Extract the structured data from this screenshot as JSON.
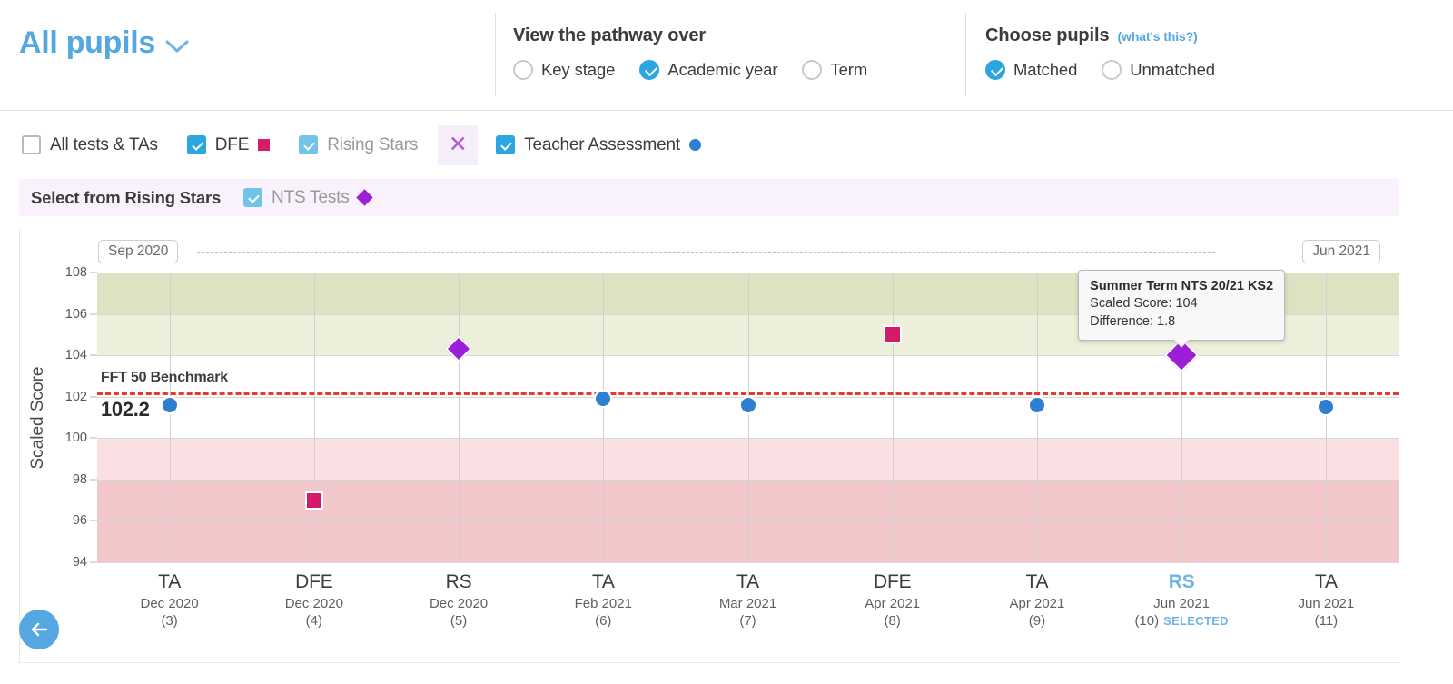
{
  "header": {
    "pupil_selector_label": "All pupils",
    "pathway": {
      "title": "View the pathway over",
      "options": [
        {
          "label": "Key stage",
          "checked": false
        },
        {
          "label": "Academic year",
          "checked": true
        },
        {
          "label": "Term",
          "checked": false
        }
      ]
    },
    "choose_pupils": {
      "title": "Choose pupils",
      "help_link": "(what's this?)",
      "options": [
        {
          "label": "Matched",
          "checked": true
        },
        {
          "label": "Unmatched",
          "checked": false
        }
      ]
    }
  },
  "filters": {
    "items": [
      {
        "label": "All tests & TAs",
        "checked": false,
        "swatch": "none",
        "muted": false
      },
      {
        "label": "DFE",
        "checked": true,
        "swatch": "square",
        "muted": false
      },
      {
        "label": "Rising Stars",
        "checked": true,
        "swatch": "none",
        "muted": true
      },
      {
        "label": "Teacher Assessment",
        "checked": true,
        "swatch": "dot",
        "muted": false
      }
    ],
    "remove_label": "✕"
  },
  "subfilter": {
    "title": "Select from Rising Stars",
    "items": [
      {
        "label": "NTS Tests",
        "checked": true,
        "swatch": "diamond",
        "muted": true
      }
    ]
  },
  "chart_data": {
    "type": "scatter",
    "title": "",
    "xlabel": "",
    "ylabel": "Scaled Score",
    "ylim": [
      94,
      108
    ],
    "yticks": [
      94,
      96,
      98,
      100,
      102,
      104,
      106,
      108
    ],
    "grid": true,
    "range_start": "Sep 2020",
    "range_end": "Jun 2021",
    "benchmark": {
      "label": "FFT 50 Benchmark",
      "value": "102.2",
      "y": 102.2,
      "color": "#e8382f"
    },
    "bands": [
      {
        "from": 106,
        "to": 108,
        "color": "#dde2c2"
      },
      {
        "from": 104,
        "to": 106,
        "color": "#ecf0db"
      },
      {
        "from": 100,
        "to": 104,
        "color": "#ffffff"
      },
      {
        "from": 98,
        "to": 100,
        "color": "#fae0e2"
      },
      {
        "from": 94,
        "to": 98,
        "color": "#f2c7ca"
      }
    ],
    "series": [
      {
        "name": "Teacher Assessment",
        "marker": "circle",
        "color": "#2f7fd0"
      },
      {
        "name": "DFE",
        "marker": "square",
        "color": "#d41b6a"
      },
      {
        "name": "Rising Stars NTS",
        "marker": "diamond",
        "color": "#9b1fd6"
      }
    ],
    "points": [
      {
        "code": "TA",
        "date": "Dec 2020",
        "index": "(3)",
        "value": 101.6,
        "marker": "circle",
        "selected": false
      },
      {
        "code": "DFE",
        "date": "Dec 2020",
        "index": "(4)",
        "value": 97.0,
        "marker": "square",
        "selected": false
      },
      {
        "code": "RS",
        "date": "Dec 2020",
        "index": "(5)",
        "value": 104.3,
        "marker": "diamond",
        "selected": false
      },
      {
        "code": "TA",
        "date": "Feb 2021",
        "index": "(6)",
        "value": 101.9,
        "marker": "circle",
        "selected": false
      },
      {
        "code": "TA",
        "date": "Mar 2021",
        "index": "(7)",
        "value": 101.6,
        "marker": "circle",
        "selected": false
      },
      {
        "code": "DFE",
        "date": "Apr 2021",
        "index": "(8)",
        "value": 105.0,
        "marker": "square",
        "selected": false
      },
      {
        "code": "TA",
        "date": "Apr 2021",
        "index": "(9)",
        "value": 101.6,
        "marker": "circle",
        "selected": false
      },
      {
        "code": "RS",
        "date": "Jun 2021",
        "index": "(10)",
        "value": 104.0,
        "marker": "diamond",
        "selected": true,
        "selected_tag": "SELECTED"
      },
      {
        "code": "TA",
        "date": "Jun 2021",
        "index": "(11)",
        "value": 101.5,
        "marker": "circle",
        "selected": false
      }
    ],
    "tooltip": {
      "title": "Summer Term NTS 20/21 KS2",
      "line1": "Scaled Score: 104",
      "line2": "Difference: 1.8",
      "point_index": 7
    }
  },
  "back_button": {
    "name": "back"
  }
}
